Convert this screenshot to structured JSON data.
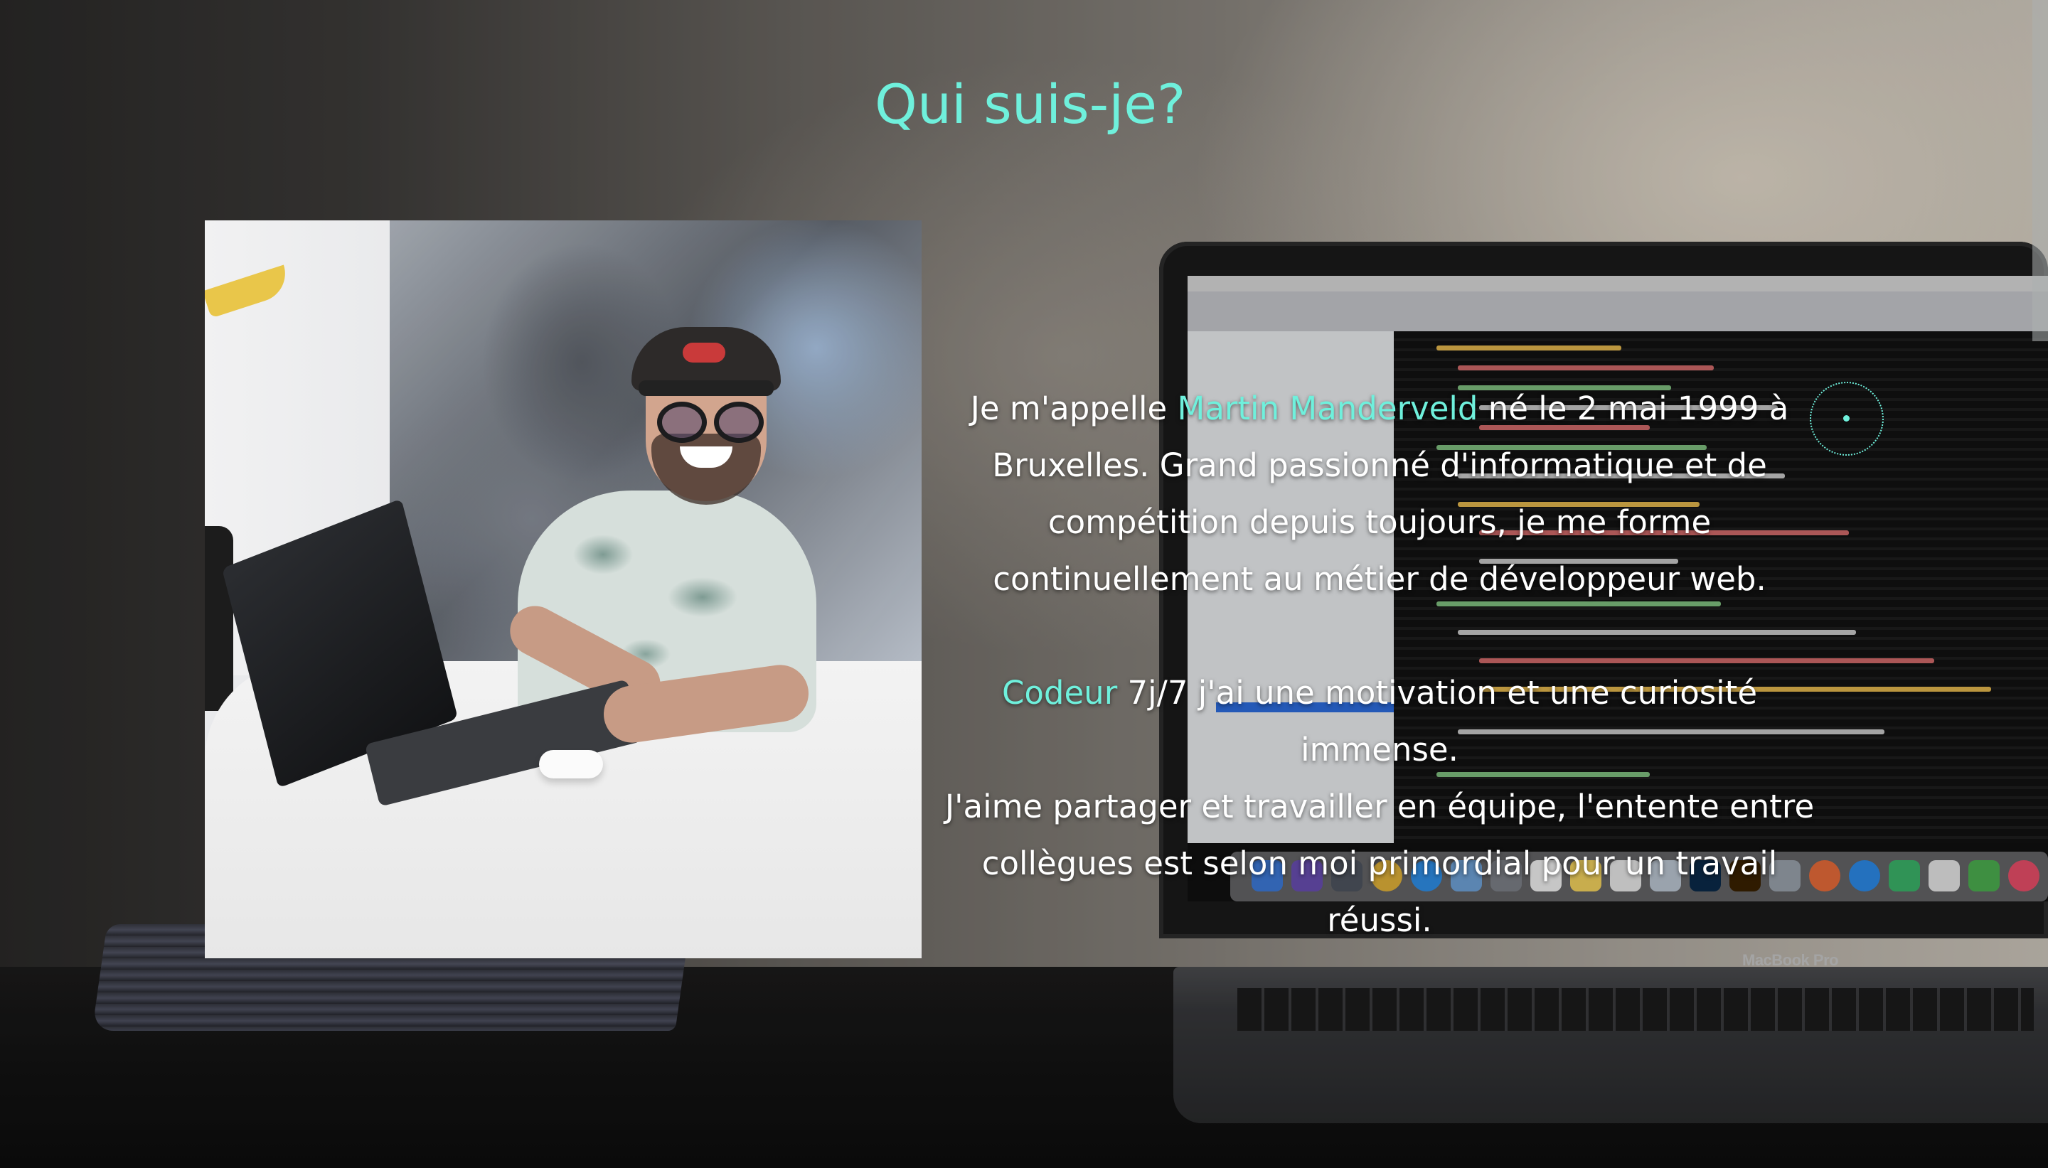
{
  "section": {
    "heading": "Qui suis-je?",
    "portrait_alt": "Portrait de Martin Manderveld"
  },
  "bio": {
    "p1_before": "Je m'appelle ",
    "p1_name": "Martin Manderveld",
    "p1_line1_after": " né le 2 mai 1999 à",
    "p1_line2": "Bruxelles. Grand passionné d'informatique et de",
    "p1_line3": "compétition depuis toujours, je me forme",
    "p1_line4": "continuellement au métier de développeur web.",
    "p2_accent": "Codeur",
    "p2_line1_after": " 7j/7 j'ai une motivation et une curiosité immense.",
    "p2_line2": "J'aime partager et travailler en équipe, l'entente entre",
    "p2_line3": "collègues est selon moi primordial pour un travail réussi."
  },
  "background": {
    "laptop_brand": "MacBook Pro"
  },
  "colors": {
    "accent": "#6ff0dc",
    "text": "#ffffff"
  },
  "icons": {
    "cursor": "dotted-circle-cursor-icon"
  }
}
